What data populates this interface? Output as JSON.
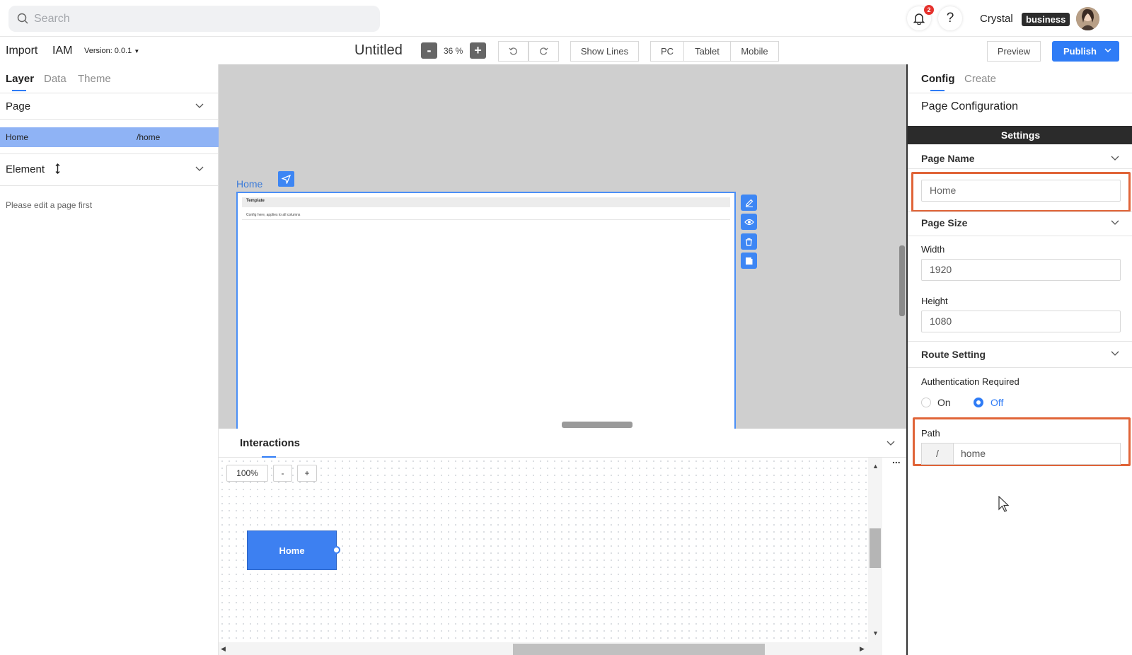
{
  "header": {
    "search_placeholder": "Search",
    "notification_count": "2",
    "help_label": "?",
    "user_name": "Crystal",
    "plan_badge": "business"
  },
  "toolbar": {
    "import_label": "Import",
    "iam_label": "IAM",
    "version_label": "Version: 0.0.1",
    "doc_title": "Untitled",
    "zoom_out": "-",
    "zoom_level": "36 %",
    "zoom_in": "+",
    "show_lines": "Show Lines",
    "devices": [
      "PC",
      "Tablet",
      "Mobile"
    ],
    "preview": "Preview",
    "publish": "Publish"
  },
  "left_panel": {
    "tabs": [
      "Layer",
      "Data",
      "Theme"
    ],
    "page_section": "Page",
    "page_row": {
      "name": "Home",
      "path": "/home"
    },
    "element_section": "Element",
    "hint": "Please edit a page first"
  },
  "canvas": {
    "frame_label": "Home",
    "frame_header": "Template",
    "frame_sub": "Config here, applies to all columns"
  },
  "interactions": {
    "title": "Interactions",
    "zoom_level": "100%",
    "zoom_out": "-",
    "zoom_in": "+",
    "more": "...",
    "node_label": "Home"
  },
  "right_panel": {
    "tabs": [
      "Config",
      "Create"
    ],
    "title": "Page Configuration",
    "settings_bar": "Settings",
    "page_name_section": "Page Name",
    "page_name_placeholder": "Home",
    "page_size_section": "Page Size",
    "width_label": "Width",
    "width_value": "1920",
    "height_label": "Height",
    "height_value": "1080",
    "route_section": "Route Setting",
    "auth_label": "Authentication Required",
    "auth_on": "On",
    "auth_off": "Off",
    "auth_selected": "Off",
    "path_label": "Path",
    "path_prefix": "/",
    "path_value": "home"
  },
  "colors": {
    "accent": "#2f7cf6",
    "highlight_box": "#e06438",
    "selected_row": "#8fb3f5"
  }
}
